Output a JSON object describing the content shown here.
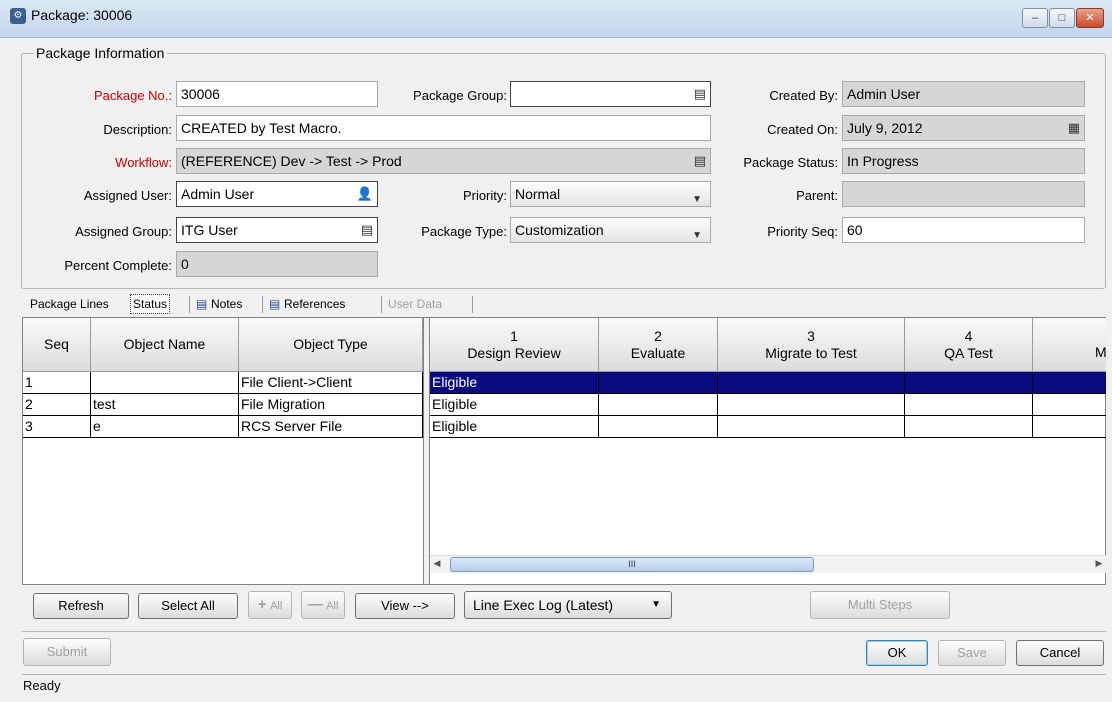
{
  "window": {
    "title": "Package: 30006",
    "minimize_glyph": "–",
    "maximize_glyph": "□",
    "close_glyph": "✕"
  },
  "package_info": {
    "legend": "Package Information",
    "package_no": {
      "label": "Package No.:",
      "value": "30006"
    },
    "package_group": {
      "label": "Package Group:",
      "value": ""
    },
    "created_by": {
      "label": "Created By:",
      "value": "Admin User"
    },
    "description": {
      "label": "Description:",
      "value": "CREATED by Test Macro."
    },
    "created_on": {
      "label": "Created On:",
      "value": "July 9, 2012"
    },
    "workflow": {
      "label": "Workflow:",
      "value": "(REFERENCE) Dev -> Test -> Prod"
    },
    "package_status": {
      "label": "Package Status:",
      "value": "In Progress"
    },
    "assigned_user": {
      "label": "Assigned User:",
      "value": "Admin User"
    },
    "priority": {
      "label": "Priority:",
      "value": "Normal"
    },
    "parent": {
      "label": "Parent:",
      "value": ""
    },
    "assigned_group": {
      "label": "Assigned Group:",
      "value": "ITG User"
    },
    "package_type": {
      "label": "Package Type:",
      "value": "Customization"
    },
    "priority_seq": {
      "label": "Priority Seq:",
      "value": "60"
    },
    "percent_complete": {
      "label": "Percent Complete:",
      "value": "0"
    }
  },
  "tabs": [
    {
      "label": "Package Lines"
    },
    {
      "label": "Status"
    },
    {
      "label": "Notes"
    },
    {
      "label": "References"
    },
    {
      "label": "User Data"
    }
  ],
  "left_table": {
    "headers": [
      "Seq",
      "Object Name",
      "Object Type"
    ],
    "rows": [
      [
        "1",
        "",
        "File Client->Client"
      ],
      [
        "2",
        "test",
        "File Migration"
      ],
      [
        "3",
        "e",
        "RCS Server File"
      ]
    ]
  },
  "right_table": {
    "headers": [
      {
        "num": "1",
        "name": "Design Review"
      },
      {
        "num": "2",
        "name": "Evaluate"
      },
      {
        "num": "3",
        "name": "Migrate to Test"
      },
      {
        "num": "4",
        "name": "QA Test"
      },
      {
        "num": "",
        "name": "Migr"
      }
    ],
    "rows": [
      [
        "Eligible",
        "",
        "",
        "",
        ""
      ],
      [
        "Eligible",
        "",
        "",
        "",
        ""
      ],
      [
        "Eligible",
        "",
        "",
        "",
        ""
      ]
    ],
    "scroll_grip": "III"
  },
  "actions": {
    "refresh": "Refresh",
    "select_all": "Select All",
    "expand_all": "All",
    "collapse_all": "All",
    "view": "View -->",
    "log_select": "Line Exec Log (Latest)",
    "multi_steps": "Multi Steps"
  },
  "footer": {
    "submit": "Submit",
    "ok": "OK",
    "save": "Save",
    "cancel": "Cancel"
  },
  "status_bar": {
    "text": "Ready"
  }
}
